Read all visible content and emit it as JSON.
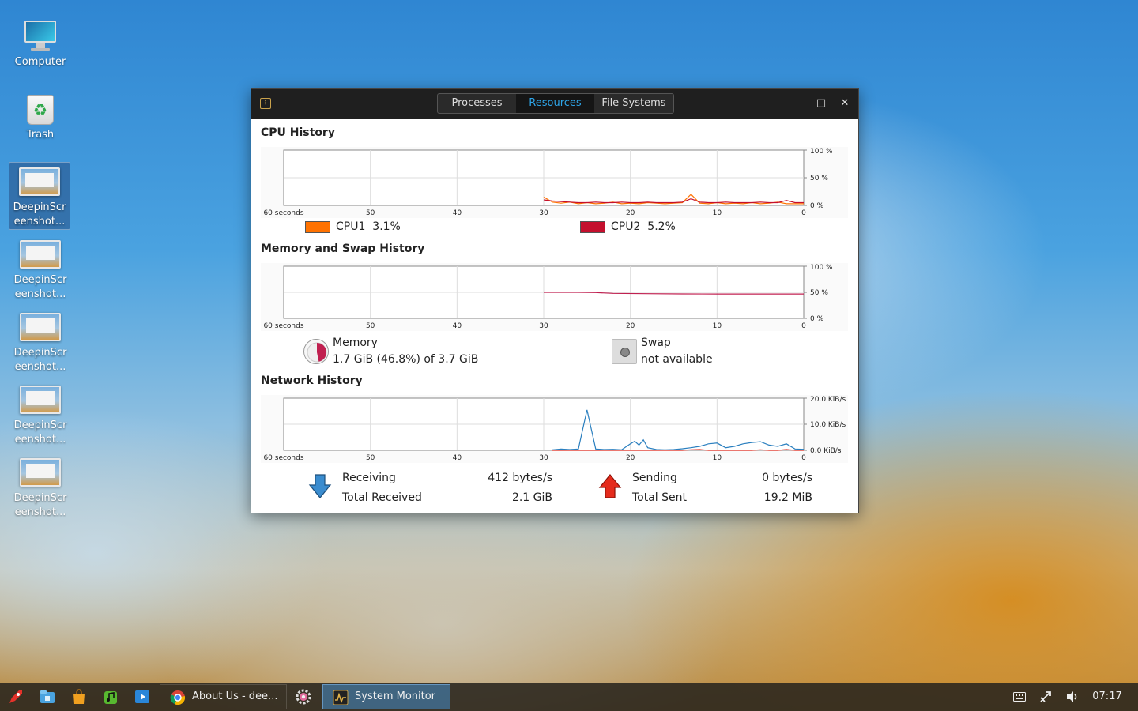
{
  "desktop": {
    "icons": [
      {
        "label": "Computer",
        "icon": "computer-icon"
      },
      {
        "label": "Trash",
        "icon": "trash-icon"
      },
      {
        "label": "DeepinScreenshot...",
        "icon": "screenshot-file-icon",
        "selected": true
      },
      {
        "label": "DeepinScreenshot...",
        "icon": "screenshot-file-icon"
      },
      {
        "label": "DeepinScreenshot...",
        "icon": "screenshot-file-icon"
      },
      {
        "label": "DeepinScreenshot...",
        "icon": "screenshot-file-icon"
      },
      {
        "label": "DeepinScreenshot...",
        "icon": "screenshot-file-icon"
      }
    ]
  },
  "window": {
    "tabs": [
      {
        "label": "Processes",
        "active": false
      },
      {
        "label": "Resources",
        "active": true
      },
      {
        "label": "File Systems",
        "active": false
      }
    ],
    "controls": {
      "minimize": "–",
      "maximize": "□",
      "close": "✕"
    },
    "accent_color": "#2ea5e8",
    "cpu": {
      "title": "CPU History",
      "cpus": [
        {
          "label": "CPU1",
          "value": "3.1%",
          "color": "#ff7200"
        },
        {
          "label": "CPU2",
          "value": "5.2%",
          "color": "#c4102e"
        }
      ]
    },
    "memory": {
      "title": "Memory and Swap History",
      "memory_label": "Memory",
      "memory_value": "1.7 GiB (46.8%) of 3.7 GiB",
      "memory_color": "#c02050",
      "swap_label": "Swap",
      "swap_value": "not available"
    },
    "network": {
      "title": "Network History",
      "receiving_label": "Receiving",
      "receiving_value": "412 bytes/s",
      "total_received_label": "Total Received",
      "total_received_value": "2.1 GiB",
      "sending_label": "Sending",
      "sending_value": "0 bytes/s",
      "total_sent_label": "Total Sent",
      "total_sent_value": "19.2 MiB",
      "receive_color": "#2a7fbf",
      "send_color": "#e0281a"
    }
  },
  "chart_data": [
    {
      "type": "line",
      "title": "CPU History",
      "x_tick_labels": [
        "60 seconds",
        "50",
        "40",
        "30",
        "20",
        "10",
        "0"
      ],
      "y_tick_labels": [
        "100 %",
        "50 %",
        "0 %"
      ],
      "xlim": [
        60,
        0
      ],
      "ylim": [
        0,
        100
      ],
      "x": [
        30,
        29,
        28,
        27,
        26,
        25,
        24,
        23,
        22,
        21,
        20,
        19,
        18,
        17,
        16,
        15,
        14,
        13,
        12,
        11,
        10,
        9,
        8,
        7,
        6,
        5,
        4,
        3,
        2,
        1,
        0
      ],
      "series": [
        {
          "name": "CPU1",
          "color": "#ff7200",
          "values": [
            15,
            6,
            4,
            6,
            3,
            5,
            3,
            4,
            6,
            3,
            4,
            3,
            5,
            4,
            3,
            4,
            5,
            20,
            4,
            3,
            5,
            3,
            4,
            3,
            5,
            3,
            4,
            6,
            3,
            3,
            3
          ]
        },
        {
          "name": "CPU2",
          "color": "#c4102e",
          "values": [
            10,
            8,
            7,
            6,
            5,
            5,
            6,
            5,
            5,
            6,
            5,
            5,
            6,
            5,
            5,
            5,
            6,
            12,
            6,
            5,
            5,
            6,
            5,
            5,
            5,
            6,
            5,
            5,
            9,
            5,
            5
          ]
        }
      ]
    },
    {
      "type": "line",
      "title": "Memory and Swap History",
      "x_tick_labels": [
        "60 seconds",
        "50",
        "40",
        "30",
        "20",
        "10",
        "0"
      ],
      "y_tick_labels": [
        "100 %",
        "50 %",
        "0 %"
      ],
      "xlim": [
        60,
        0
      ],
      "ylim": [
        0,
        100
      ],
      "x": [
        30,
        26,
        24,
        22,
        18,
        14,
        10,
        6,
        2,
        0
      ],
      "series": [
        {
          "name": "Memory",
          "color": "#c02050",
          "values": [
            50,
            50,
            49.5,
            48,
            47.5,
            47,
            46.8,
            46.8,
            46.8,
            46.8
          ]
        }
      ]
    },
    {
      "type": "line",
      "title": "Network History",
      "x_tick_labels": [
        "60 seconds",
        "50",
        "40",
        "30",
        "20",
        "10",
        "0"
      ],
      "y_tick_labels": [
        "20.0 KiB/s",
        "10.0 KiB/s",
        "0.0 KiB/s"
      ],
      "xlim": [
        60,
        0
      ],
      "ylim": [
        0,
        20
      ],
      "x": [
        29,
        28,
        27,
        26,
        25.5,
        25,
        24.5,
        24,
        23,
        22,
        21,
        20,
        19.5,
        19,
        18.5,
        18,
        17,
        16,
        15,
        14,
        13,
        12,
        11,
        10,
        9,
        8,
        7,
        6,
        5,
        4,
        3,
        2,
        1,
        0
      ],
      "series": [
        {
          "name": "Receiving",
          "color": "#2a7fbf",
          "values": [
            0.2,
            0.5,
            0.3,
            0.5,
            8,
            15.5,
            8,
            0.5,
            0.3,
            0.4,
            0.2,
            2.5,
            3.5,
            2,
            4,
            1,
            0.3,
            0.2,
            0.3,
            0.6,
            1,
            1.5,
            2.5,
            2.8,
            1,
            1.5,
            2.5,
            3,
            3.3,
            2,
            1.5,
            2.5,
            0.5,
            0.4
          ]
        },
        {
          "name": "Sending",
          "color": "#e0281a",
          "values": [
            0,
            0,
            0,
            0,
            0,
            0,
            0,
            0,
            0,
            0,
            0,
            0,
            0,
            0,
            0,
            0,
            0,
            0,
            0,
            0,
            0.2,
            0.3,
            0,
            0,
            0,
            0,
            0,
            0,
            0.2,
            0,
            0,
            0.3,
            0,
            0
          ]
        }
      ]
    }
  ],
  "taskbar": {
    "launchers": [
      {
        "icon": "launcher-rocket-icon"
      },
      {
        "icon": "file-manager-icon"
      },
      {
        "icon": "store-bag-icon"
      },
      {
        "icon": "music-player-icon"
      },
      {
        "icon": "video-player-icon"
      }
    ],
    "tasks": [
      {
        "label": "About Us - dee...",
        "icon": "chrome-icon",
        "active": false
      },
      {
        "label": "",
        "icon": "settings-icon",
        "active": false
      },
      {
        "label": "System Monitor",
        "icon": "system-monitor-icon",
        "active": true
      }
    ],
    "tray": {
      "keyboard": "keyboard-icon",
      "network": "network-icon",
      "volume": "volume-icon",
      "clock": "07:17"
    }
  }
}
